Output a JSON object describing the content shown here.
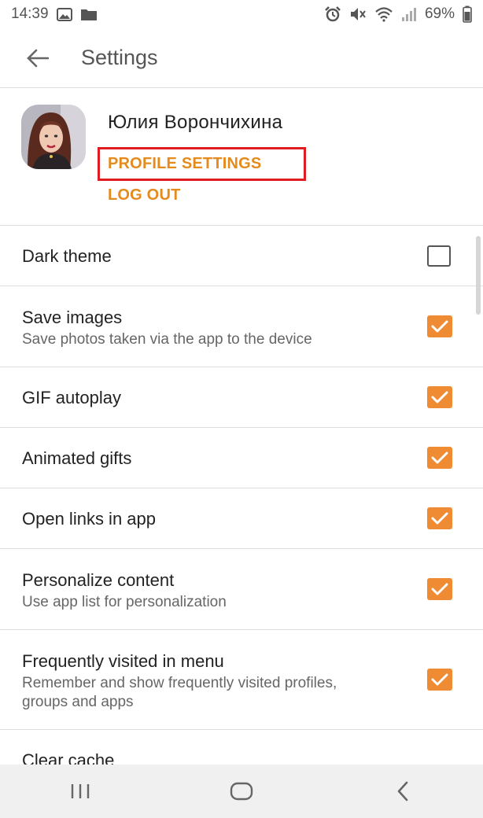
{
  "status_bar": {
    "time": "14:39",
    "battery": "69%",
    "icons_left": [
      "image-icon",
      "folder-icon"
    ],
    "icons_right": [
      "alarm-icon",
      "mute-icon",
      "wifi-icon",
      "signal-icon"
    ]
  },
  "appbar": {
    "title": "Settings",
    "back_icon": "arrow-left-icon"
  },
  "profile": {
    "name": "Юлия Ворончихина",
    "settings_label": "PROFILE SETTINGS",
    "logout_label": "LOG OUT"
  },
  "settings": [
    {
      "title": "Dark theme",
      "subtitle": "",
      "checked": false
    },
    {
      "title": "Save images",
      "subtitle": "Save photos taken via the app to the device",
      "checked": true
    },
    {
      "title": "GIF autoplay",
      "subtitle": "",
      "checked": true
    },
    {
      "title": "Animated gifts",
      "subtitle": "",
      "checked": true
    },
    {
      "title": "Open links in app",
      "subtitle": "",
      "checked": true
    },
    {
      "title": "Personalize content",
      "subtitle": "Use app list for personalization",
      "checked": true
    },
    {
      "title": "Frequently visited in menu",
      "subtitle": "Remember and show frequently visited profiles, groups and apps",
      "checked": true
    },
    {
      "title": "Clear cache",
      "subtitle": "",
      "checked": null
    }
  ],
  "navbar": {
    "icons": [
      "recent-apps-icon",
      "home-icon",
      "back-icon"
    ]
  },
  "colors": {
    "accent": "#e58b1d",
    "checkbox": "#ef8b32",
    "highlight": "#e01b22"
  }
}
